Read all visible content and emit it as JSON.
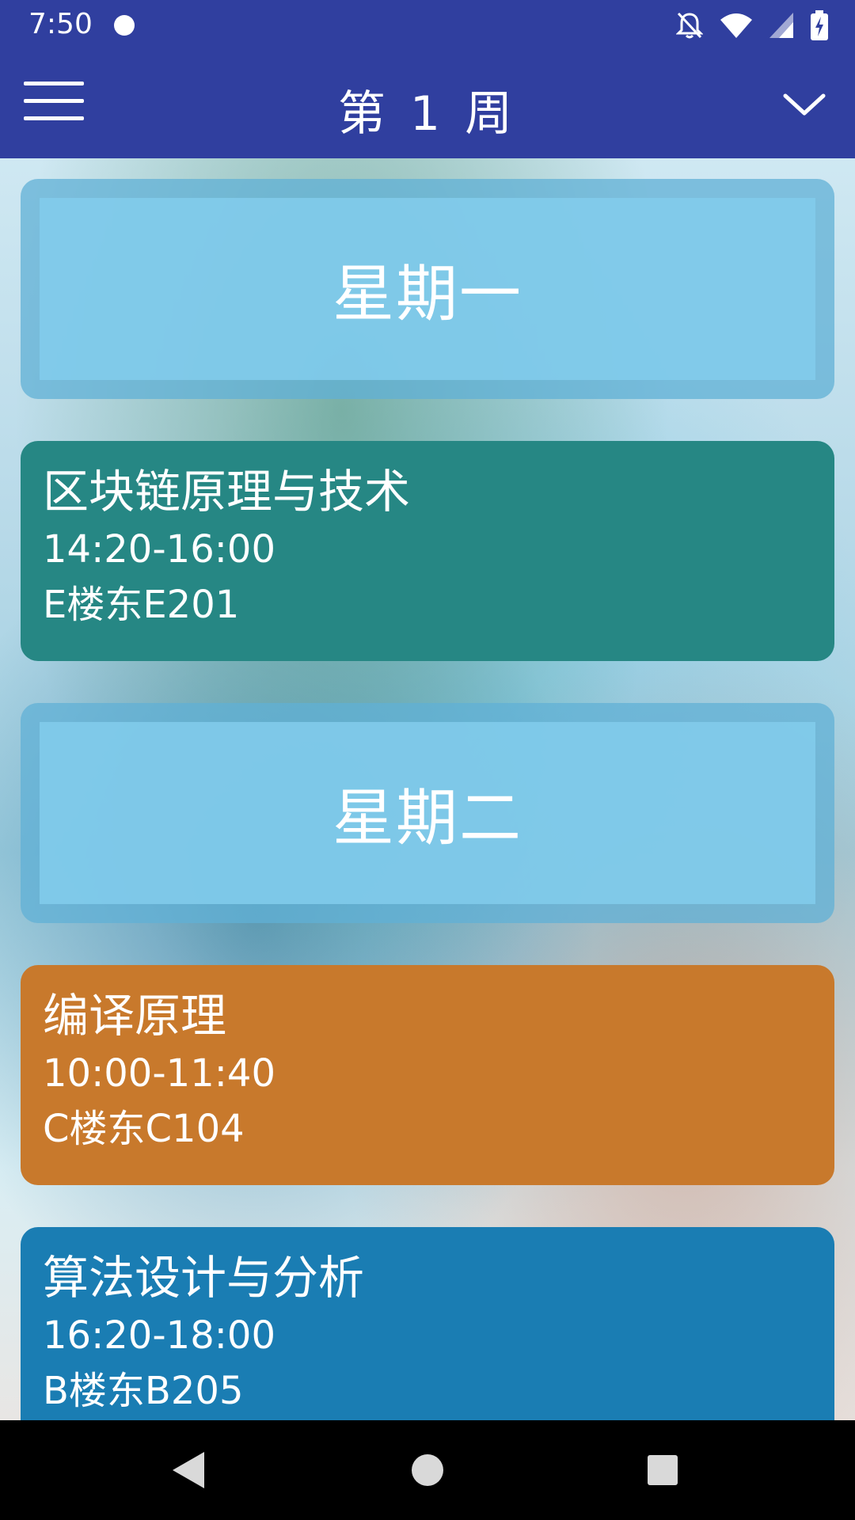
{
  "status_bar": {
    "time": "7:50",
    "icons": [
      "notification-dot-icon",
      "notifications-off-icon",
      "wifi-icon",
      "signal-icon",
      "battery-charging-icon"
    ]
  },
  "app_bar": {
    "title": "第 1 周",
    "menu_icon": "hamburger-menu-icon",
    "dropdown_icon": "chevron-down-icon",
    "color": "#303f9f"
  },
  "schedule": {
    "monday": {
      "label": "星期一",
      "courses": [
        {
          "name": "区块链原理与技术",
          "time": "14:20-16:00",
          "room": "E楼东E201",
          "color": "#268784"
        }
      ]
    },
    "tuesday": {
      "label": "星期二",
      "courses": [
        {
          "name": "编译原理",
          "time": "10:00-11:40",
          "room": "C楼东C104",
          "color": "#c8792c"
        },
        {
          "name": "算法设计与分析",
          "time": "16:20-18:00",
          "room": "B楼东B205",
          "color": "#1a7db3"
        }
      ]
    }
  },
  "nav_bar": {
    "back_icon": "back-triangle-icon",
    "home_icon": "home-circle-icon",
    "recents_icon": "recents-square-icon"
  }
}
